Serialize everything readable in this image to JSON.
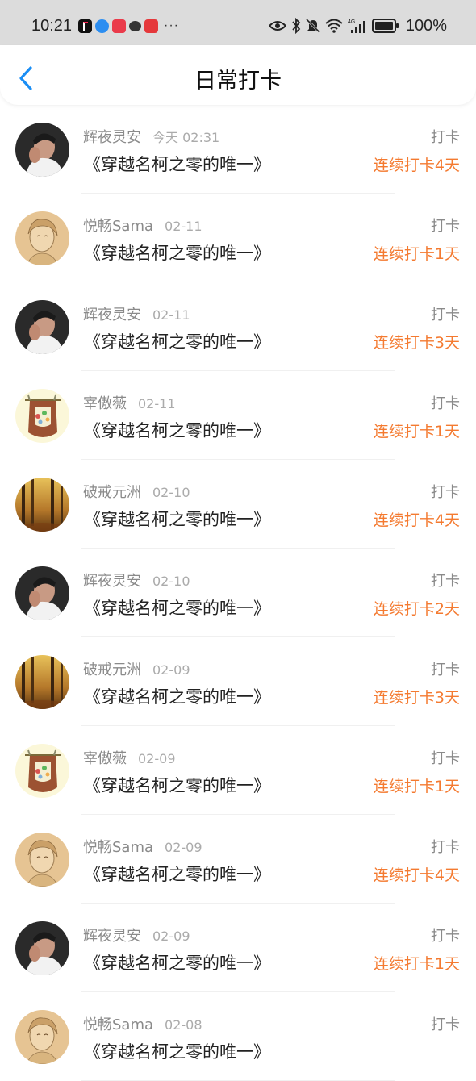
{
  "status_bar": {
    "time": "10:21",
    "battery_text": "100%",
    "more": "···",
    "network_label": "4G"
  },
  "header": {
    "title": "日常打卡",
    "back_icon": "chevron-left-icon"
  },
  "colors": {
    "accent_orange": "#f47a30",
    "back_blue": "#1a8ef5",
    "muted_text": "#8a8a8a"
  },
  "checkins": [
    {
      "user": "辉夜灵安",
      "time": "今天 02:31",
      "book": "《穿越名柯之零的唯一》",
      "action": "打卡",
      "streak": "连续打卡4天",
      "avatar": "man"
    },
    {
      "user": "悦畅Sama",
      "time": "02-11",
      "book": "《穿越名柯之零的唯一》",
      "action": "打卡",
      "streak": "连续打卡1天",
      "avatar": "sketch"
    },
    {
      "user": "辉夜灵安",
      "time": "02-11",
      "book": "《穿越名柯之零的唯一》",
      "action": "打卡",
      "streak": "连续打卡3天",
      "avatar": "man"
    },
    {
      "user": "宰傲薇",
      "time": "02-11",
      "book": "《穿越名柯之零的唯一》",
      "action": "打卡",
      "streak": "连续打卡1天",
      "avatar": "pot"
    },
    {
      "user": "破戒元洲",
      "time": "02-10",
      "book": "《穿越名柯之零的唯一》",
      "action": "打卡",
      "streak": "连续打卡4天",
      "avatar": "forest"
    },
    {
      "user": "辉夜灵安",
      "time": "02-10",
      "book": "《穿越名柯之零的唯一》",
      "action": "打卡",
      "streak": "连续打卡2天",
      "avatar": "man"
    },
    {
      "user": "破戒元洲",
      "time": "02-09",
      "book": "《穿越名柯之零的唯一》",
      "action": "打卡",
      "streak": "连续打卡3天",
      "avatar": "forest"
    },
    {
      "user": "宰傲薇",
      "time": "02-09",
      "book": "《穿越名柯之零的唯一》",
      "action": "打卡",
      "streak": "连续打卡1天",
      "avatar": "pot"
    },
    {
      "user": "悦畅Sama",
      "time": "02-09",
      "book": "《穿越名柯之零的唯一》",
      "action": "打卡",
      "streak": "连续打卡4天",
      "avatar": "sketch"
    },
    {
      "user": "辉夜灵安",
      "time": "02-09",
      "book": "《穿越名柯之零的唯一》",
      "action": "打卡",
      "streak": "连续打卡1天",
      "avatar": "man"
    },
    {
      "user": "悦畅Sama",
      "time": "02-08",
      "book": "《穿越名柯之零的唯一》",
      "action": "打卡",
      "streak": "",
      "avatar": "sketch"
    }
  ]
}
